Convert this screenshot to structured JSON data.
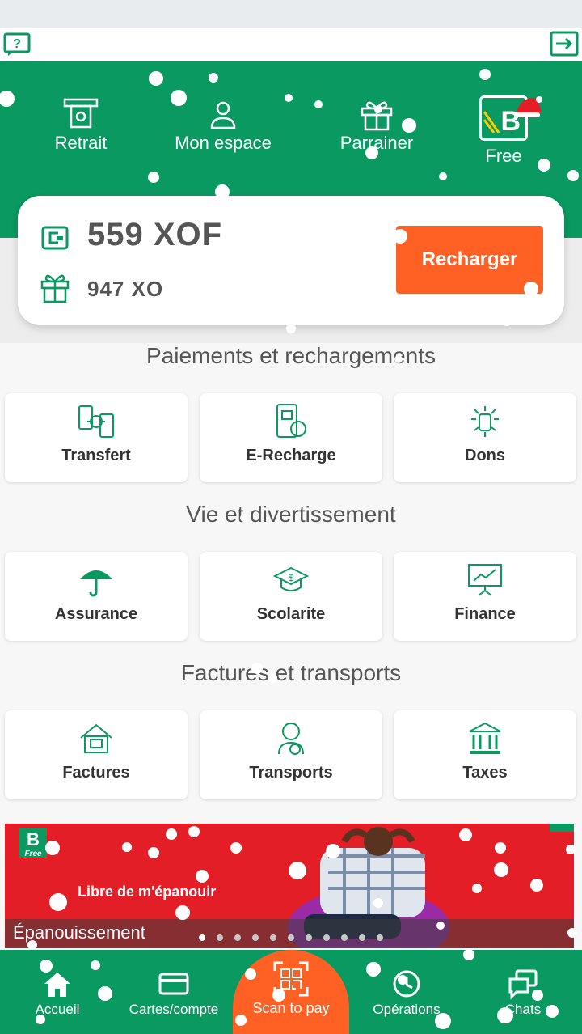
{
  "colors": {
    "primary": "#0a9960",
    "accent": "#ff6124",
    "banner": "#e31e26"
  },
  "header": {
    "items": [
      {
        "label": "Retrait",
        "icon": "atm-icon"
      },
      {
        "label": "Mon espace",
        "icon": "user-icon"
      },
      {
        "label": "Parrainer",
        "icon": "gift-icon"
      }
    ],
    "free_label": "Free",
    "free_letter": "B"
  },
  "balance": {
    "amount": "559  XOF",
    "bonus": "947  XO",
    "recharge_label": "Recharger"
  },
  "sections": [
    {
      "title": "Paiements et rechargements",
      "tiles": [
        {
          "label": "Transfert",
          "icon": "transfer-icon"
        },
        {
          "label": "E-Recharge",
          "icon": "phone-recharge-icon"
        },
        {
          "label": "Dons",
          "icon": "donation-icon"
        }
      ]
    },
    {
      "title": "Vie et divertissement",
      "tiles": [
        {
          "label": "Assurance",
          "icon": "umbrella-icon"
        },
        {
          "label": "Scolarite",
          "icon": "graduation-icon"
        },
        {
          "label": "Finance",
          "icon": "chart-board-icon"
        }
      ]
    },
    {
      "title": "Factures et transports",
      "tiles": [
        {
          "label": "Factures",
          "icon": "house-bill-icon"
        },
        {
          "label": "Transports",
          "icon": "driver-icon"
        },
        {
          "label": "Taxes",
          "icon": "bank-icon"
        }
      ]
    }
  ],
  "banner": {
    "logo_letter": "B",
    "logo_sub": "Free",
    "tagline": "Libre de m'épanouir",
    "caption": "Épanouissement",
    "dot_count": 11,
    "active_dot": 0
  },
  "bottom_nav": [
    {
      "label": "Accueil",
      "icon": "home-icon"
    },
    {
      "label": "Cartes/compte",
      "icon": "card-icon"
    },
    {
      "label": "Scan to pay",
      "icon": "qr-scan-icon"
    },
    {
      "label": "Opérations",
      "icon": "clock-icon"
    },
    {
      "label": "Chats",
      "icon": "chat-icon"
    }
  ]
}
